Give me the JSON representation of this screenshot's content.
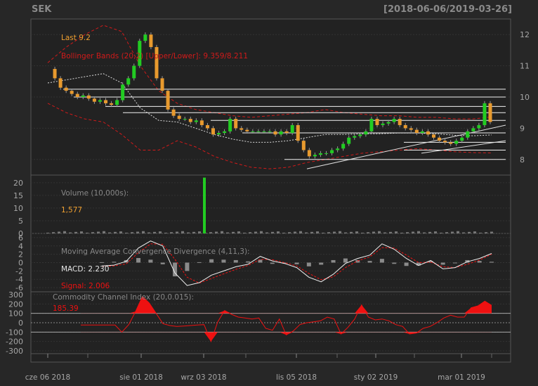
{
  "header": {
    "symbol": "SEK",
    "date_range": "[2018-06-06/2019-03-26]"
  },
  "colors": {
    "bg": "#272727",
    "panel": "#222222",
    "up": "#22cc22",
    "down": "#e89a2e",
    "bband": "#d11a1a",
    "text_light": "#a6a6a6",
    "last": "#f0a030",
    "signal": "#ee1111",
    "volume_label": "#888888",
    "cci": "#ee1111"
  },
  "annotations": {
    "last": "Last 9.2",
    "bbands": "Bollinger Bands (20,2) [Upper/Lower]: 9.359/8.211",
    "volume_title": "Volume (10,000s):",
    "volume_value": "1,577",
    "macd_title": "Moving Average Convergence Divergence (4,11,3):",
    "macd_value": "MACD: 2.230",
    "signal_value": "Signal: 2.006",
    "cci_title": "Commodity Channel Index (20,0.015):",
    "cci_value": "185.39"
  },
  "chart_data": [
    {
      "type": "candlestick",
      "panel": "price",
      "y_ticks": [
        "8",
        "9",
        "10",
        "11",
        "12"
      ],
      "ylim": [
        7.5,
        12.5
      ],
      "n_bars": 200,
      "close_approx": [
        10.9,
        10.6,
        10.3,
        10.2,
        10.1,
        10.0,
        10.05,
        9.95,
        9.85,
        9.9,
        9.8,
        9.75,
        9.9,
        10.4,
        10.6,
        11.0,
        11.8,
        12.0,
        11.6,
        10.6,
        10.2,
        9.6,
        9.4,
        9.3,
        9.3,
        9.2,
        9.25,
        9.1,
        9.0,
        8.8,
        8.85,
        8.9,
        9.3,
        9.0,
        8.95,
        8.9,
        8.9,
        8.9,
        8.9,
        8.9,
        8.8,
        8.9,
        8.85,
        9.1,
        8.6,
        8.3,
        8.1,
        8.15,
        8.2,
        8.2,
        8.3,
        8.35,
        8.5,
        8.7,
        8.75,
        8.8,
        8.9,
        9.3,
        9.1,
        9.15,
        9.2,
        9.3,
        9.1,
        9.0,
        8.95,
        8.85,
        8.9,
        8.8,
        8.7,
        8.6,
        8.55,
        8.5,
        8.6,
        8.7,
        8.9,
        9.0,
        9.1,
        9.8,
        9.2
      ],
      "bband_upper_approx": [
        11.1,
        11.6,
        12.0,
        12.3,
        12.1,
        11.0,
        10.2,
        9.8,
        9.6,
        9.5,
        9.4,
        9.35,
        9.4,
        9.45,
        9.5,
        9.6,
        9.5,
        9.45,
        9.4,
        9.4,
        9.35,
        9.35,
        9.3,
        9.3,
        9.36
      ],
      "bband_lower_approx": [
        9.8,
        9.5,
        9.3,
        9.2,
        8.8,
        8.3,
        8.3,
        8.6,
        8.4,
        8.1,
        7.9,
        7.75,
        7.7,
        7.75,
        7.9,
        8.0,
        8.1,
        8.2,
        8.25,
        8.3,
        8.35,
        8.3,
        8.25,
        8.22,
        8.21
      ],
      "support_levels": [
        10.25,
        10.0,
        9.7,
        9.5,
        9.25,
        8.85,
        8.55,
        8.3,
        8.0
      ],
      "trendlines": [
        [
          7.7,
          9.1
        ],
        [
          8.2,
          8.6
        ]
      ]
    },
    {
      "type": "bar",
      "panel": "volume",
      "y_ticks": [
        "0",
        "5",
        "10",
        "15",
        "20"
      ],
      "ylim": [
        0,
        23
      ],
      "notable": [
        {
          "bar_fraction": 0.34,
          "value": 22
        }
      ]
    },
    {
      "type": "line",
      "panel": "macd",
      "y_ticks": [
        "-6",
        "-4",
        "-2",
        "0",
        "2",
        "4",
        "6"
      ],
      "ylim": [
        -7,
        7
      ],
      "series": [
        {
          "name": "MACD",
          "values": [
            -0.8,
            -0.6,
            0.3,
            3.5,
            5.2,
            4.0,
            -2.5,
            -5.5,
            -4.8,
            -3.0,
            -2.0,
            -1.0,
            -0.4,
            1.5,
            0.4,
            -0.2,
            -1.2,
            -3.5,
            -4.6,
            -2.8,
            -0.2,
            1.0,
            1.8,
            4.5,
            3.2,
            1.0,
            -0.7,
            0.5,
            -1.5,
            -1.2,
            0.2,
            1.0,
            2.2
          ]
        },
        {
          "name": "Signal",
          "values": [
            -0.9,
            -0.8,
            -0.3,
            2.4,
            4.5,
            4.4,
            0.8,
            -3.5,
            -4.9,
            -3.8,
            -2.7,
            -1.6,
            -0.7,
            0.8,
            0.7,
            0.0,
            -0.8,
            -2.6,
            -4.1,
            -3.4,
            -1.2,
            0.4,
            1.4,
            3.6,
            3.5,
            1.8,
            0.0,
            0.1,
            -1.0,
            -1.2,
            -0.4,
            0.6,
            2.0
          ]
        }
      ]
    },
    {
      "type": "area",
      "panel": "cci",
      "y_ticks": [
        "-300",
        "-200",
        "-100",
        "0",
        "100",
        "200",
        "300"
      ],
      "ylim": [
        -330,
        330
      ],
      "values": [
        -25,
        -25,
        -25,
        -25,
        -25,
        -25,
        -100,
        -20,
        120,
        280,
        210,
        100,
        -10,
        -30,
        -40,
        -35,
        -30,
        -25,
        -20,
        -200,
        10,
        130,
        90,
        60,
        50,
        40,
        50,
        -60,
        -80,
        40,
        -130,
        -90,
        -20,
        0,
        10,
        20,
        60,
        40,
        -120,
        -50,
        40,
        190,
        60,
        30,
        40,
        20,
        -20,
        -40,
        -120,
        -110,
        -60,
        -40,
        0,
        50,
        80,
        60,
        60,
        160,
        180,
        230,
        185
      ]
    }
  ],
  "x_axis": {
    "ticks": [
      "cze 06 2018",
      "sie 01 2018",
      "wrz 03 2018",
      "lis 05 2018",
      "sty 02 2019",
      "mar 01 2019"
    ]
  }
}
